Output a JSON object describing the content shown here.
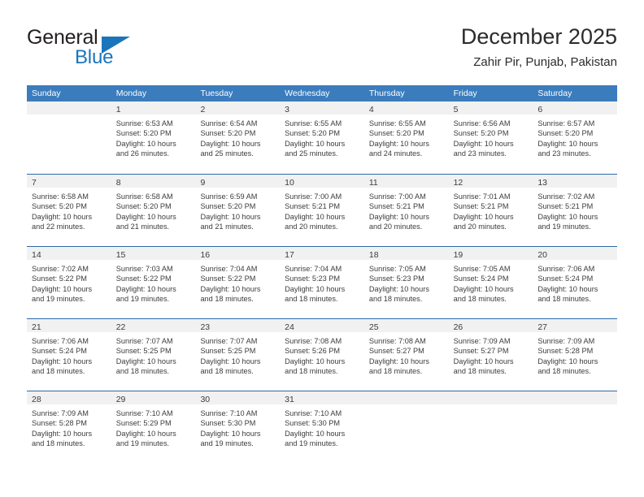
{
  "brand": {
    "name_part1": "General",
    "name_part2": "Blue",
    "triangle_icon": "triangle-icon",
    "accent_color": "#1b75bb"
  },
  "header": {
    "title": "December 2025",
    "subtitle": "Zahir Pir, Punjab, Pakistan"
  },
  "calendar": {
    "header_bg": "#3b7cbd",
    "daynum_bg": "#f1f1f1",
    "separator_color": "#2e6aa8",
    "weekday_headers": [
      "Sunday",
      "Monday",
      "Tuesday",
      "Wednesday",
      "Thursday",
      "Friday",
      "Saturday"
    ],
    "weeks": [
      [
        {
          "day": "",
          "lines": []
        },
        {
          "day": "1",
          "lines": [
            "Sunrise: 6:53 AM",
            "Sunset: 5:20 PM",
            "Daylight: 10 hours",
            "and 26 minutes."
          ]
        },
        {
          "day": "2",
          "lines": [
            "Sunrise: 6:54 AM",
            "Sunset: 5:20 PM",
            "Daylight: 10 hours",
            "and 25 minutes."
          ]
        },
        {
          "day": "3",
          "lines": [
            "Sunrise: 6:55 AM",
            "Sunset: 5:20 PM",
            "Daylight: 10 hours",
            "and 25 minutes."
          ]
        },
        {
          "day": "4",
          "lines": [
            "Sunrise: 6:55 AM",
            "Sunset: 5:20 PM",
            "Daylight: 10 hours",
            "and 24 minutes."
          ]
        },
        {
          "day": "5",
          "lines": [
            "Sunrise: 6:56 AM",
            "Sunset: 5:20 PM",
            "Daylight: 10 hours",
            "and 23 minutes."
          ]
        },
        {
          "day": "6",
          "lines": [
            "Sunrise: 6:57 AM",
            "Sunset: 5:20 PM",
            "Daylight: 10 hours",
            "and 23 minutes."
          ]
        }
      ],
      [
        {
          "day": "7",
          "lines": [
            "Sunrise: 6:58 AM",
            "Sunset: 5:20 PM",
            "Daylight: 10 hours",
            "and 22 minutes."
          ]
        },
        {
          "day": "8",
          "lines": [
            "Sunrise: 6:58 AM",
            "Sunset: 5:20 PM",
            "Daylight: 10 hours",
            "and 21 minutes."
          ]
        },
        {
          "day": "9",
          "lines": [
            "Sunrise: 6:59 AM",
            "Sunset: 5:20 PM",
            "Daylight: 10 hours",
            "and 21 minutes."
          ]
        },
        {
          "day": "10",
          "lines": [
            "Sunrise: 7:00 AM",
            "Sunset: 5:21 PM",
            "Daylight: 10 hours",
            "and 20 minutes."
          ]
        },
        {
          "day": "11",
          "lines": [
            "Sunrise: 7:00 AM",
            "Sunset: 5:21 PM",
            "Daylight: 10 hours",
            "and 20 minutes."
          ]
        },
        {
          "day": "12",
          "lines": [
            "Sunrise: 7:01 AM",
            "Sunset: 5:21 PM",
            "Daylight: 10 hours",
            "and 20 minutes."
          ]
        },
        {
          "day": "13",
          "lines": [
            "Sunrise: 7:02 AM",
            "Sunset: 5:21 PM",
            "Daylight: 10 hours",
            "and 19 minutes."
          ]
        }
      ],
      [
        {
          "day": "14",
          "lines": [
            "Sunrise: 7:02 AM",
            "Sunset: 5:22 PM",
            "Daylight: 10 hours",
            "and 19 minutes."
          ]
        },
        {
          "day": "15",
          "lines": [
            "Sunrise: 7:03 AM",
            "Sunset: 5:22 PM",
            "Daylight: 10 hours",
            "and 19 minutes."
          ]
        },
        {
          "day": "16",
          "lines": [
            "Sunrise: 7:04 AM",
            "Sunset: 5:22 PM",
            "Daylight: 10 hours",
            "and 18 minutes."
          ]
        },
        {
          "day": "17",
          "lines": [
            "Sunrise: 7:04 AM",
            "Sunset: 5:23 PM",
            "Daylight: 10 hours",
            "and 18 minutes."
          ]
        },
        {
          "day": "18",
          "lines": [
            "Sunrise: 7:05 AM",
            "Sunset: 5:23 PM",
            "Daylight: 10 hours",
            "and 18 minutes."
          ]
        },
        {
          "day": "19",
          "lines": [
            "Sunrise: 7:05 AM",
            "Sunset: 5:24 PM",
            "Daylight: 10 hours",
            "and 18 minutes."
          ]
        },
        {
          "day": "20",
          "lines": [
            "Sunrise: 7:06 AM",
            "Sunset: 5:24 PM",
            "Daylight: 10 hours",
            "and 18 minutes."
          ]
        }
      ],
      [
        {
          "day": "21",
          "lines": [
            "Sunrise: 7:06 AM",
            "Sunset: 5:24 PM",
            "Daylight: 10 hours",
            "and 18 minutes."
          ]
        },
        {
          "day": "22",
          "lines": [
            "Sunrise: 7:07 AM",
            "Sunset: 5:25 PM",
            "Daylight: 10 hours",
            "and 18 minutes."
          ]
        },
        {
          "day": "23",
          "lines": [
            "Sunrise: 7:07 AM",
            "Sunset: 5:25 PM",
            "Daylight: 10 hours",
            "and 18 minutes."
          ]
        },
        {
          "day": "24",
          "lines": [
            "Sunrise: 7:08 AM",
            "Sunset: 5:26 PM",
            "Daylight: 10 hours",
            "and 18 minutes."
          ]
        },
        {
          "day": "25",
          "lines": [
            "Sunrise: 7:08 AM",
            "Sunset: 5:27 PM",
            "Daylight: 10 hours",
            "and 18 minutes."
          ]
        },
        {
          "day": "26",
          "lines": [
            "Sunrise: 7:09 AM",
            "Sunset: 5:27 PM",
            "Daylight: 10 hours",
            "and 18 minutes."
          ]
        },
        {
          "day": "27",
          "lines": [
            "Sunrise: 7:09 AM",
            "Sunset: 5:28 PM",
            "Daylight: 10 hours",
            "and 18 minutes."
          ]
        }
      ],
      [
        {
          "day": "28",
          "lines": [
            "Sunrise: 7:09 AM",
            "Sunset: 5:28 PM",
            "Daylight: 10 hours",
            "and 18 minutes."
          ]
        },
        {
          "day": "29",
          "lines": [
            "Sunrise: 7:10 AM",
            "Sunset: 5:29 PM",
            "Daylight: 10 hours",
            "and 19 minutes."
          ]
        },
        {
          "day": "30",
          "lines": [
            "Sunrise: 7:10 AM",
            "Sunset: 5:30 PM",
            "Daylight: 10 hours",
            "and 19 minutes."
          ]
        },
        {
          "day": "31",
          "lines": [
            "Sunrise: 7:10 AM",
            "Sunset: 5:30 PM",
            "Daylight: 10 hours",
            "and 19 minutes."
          ]
        },
        {
          "day": "",
          "lines": []
        },
        {
          "day": "",
          "lines": []
        },
        {
          "day": "",
          "lines": []
        }
      ]
    ]
  }
}
